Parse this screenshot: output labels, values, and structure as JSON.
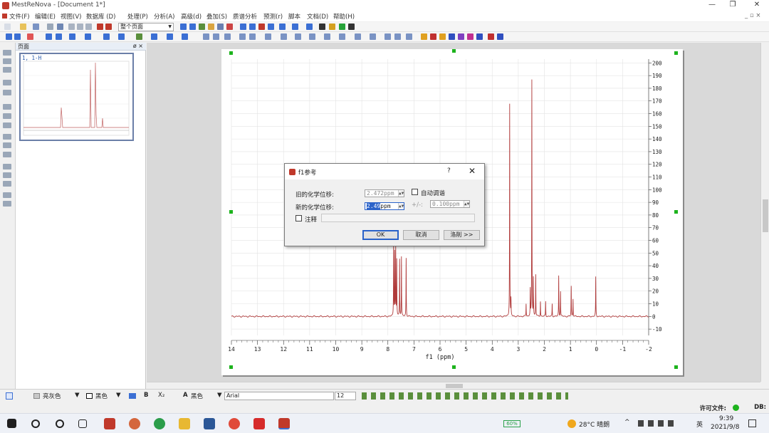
{
  "window": {
    "title": "MestReNova - [Document 1*]",
    "minimize": "—",
    "maximize": "❐",
    "close": "✕",
    "mdi_controls": "_ ▫ ×"
  },
  "menu": [
    "文件(F)",
    "编辑(E)",
    "视图(V)",
    "数据库 (D)",
    "处理(P)",
    "分析(A)",
    "高级(d)",
    "叠加(S)",
    "质谱分析",
    "预测(r)",
    "脚本",
    "文档(D)",
    "帮助(H)"
  ],
  "toolbar": {
    "page_select": "整个页面"
  },
  "pages_panel": {
    "title": "页面",
    "controls": "ø ×",
    "thumbnail_label": "1, 1-H"
  },
  "spectrum": {
    "xlabel": "f1 (ppm)",
    "x_ticks": [
      "14",
      "13",
      "12",
      "11",
      "10",
      "9",
      "8",
      "7",
      "6",
      "5",
      "4",
      "3",
      "2",
      "1",
      "0",
      "-1",
      "-2"
    ],
    "y_ticks": [
      "200",
      "190",
      "180",
      "170",
      "160",
      "150",
      "140",
      "130",
      "120",
      "110",
      "100",
      "90",
      "80",
      "70",
      "60",
      "50",
      "40",
      "30",
      "20",
      "10",
      "0",
      "-10"
    ],
    "line_color": "#b03a3a"
  },
  "chart_data": {
    "type": "line",
    "xlabel": "f1 (ppm)",
    "ylabel": "",
    "xlim": [
      14,
      -2
    ],
    "ylim": [
      -15,
      203
    ],
    "x_reversed": true,
    "grid": true,
    "series": [
      {
        "peaks": [
          {
            "ppm": 7.78,
            "height": 58
          },
          {
            "ppm": 7.74,
            "height": 50
          },
          {
            "ppm": 7.7,
            "height": 53
          },
          {
            "ppm": 7.66,
            "height": 44
          },
          {
            "ppm": 7.55,
            "height": 45
          },
          {
            "ppm": 7.48,
            "height": 47
          },
          {
            "ppm": 7.3,
            "height": 46
          },
          {
            "ppm": 3.33,
            "height": 168
          },
          {
            "ppm": 3.28,
            "height": 13
          },
          {
            "ppm": 2.7,
            "height": 10
          },
          {
            "ppm": 2.54,
            "height": 21
          },
          {
            "ppm": 2.48,
            "height": 186
          },
          {
            "ppm": 2.42,
            "height": 30
          },
          {
            "ppm": 2.33,
            "height": 33
          },
          {
            "ppm": 2.15,
            "height": 12
          },
          {
            "ppm": 1.95,
            "height": 12
          },
          {
            "ppm": 1.7,
            "height": 10
          },
          {
            "ppm": 1.45,
            "height": 32
          },
          {
            "ppm": 1.38,
            "height": 20
          },
          {
            "ppm": 0.97,
            "height": 24
          },
          {
            "ppm": 0.9,
            "height": 14
          },
          {
            "ppm": 0.03,
            "height": 31
          }
        ]
      }
    ]
  },
  "dialog": {
    "title": "f1参考",
    "help": "?",
    "close": "✕",
    "old_shift_label": "旧的化学位移:",
    "old_shift_value": "2.472ppm",
    "new_shift_label": "新的化学位移:",
    "new_shift_value": "2.49",
    "new_shift_unit": "ppm",
    "auto_tune_label": "自动调谐",
    "tolerance_prefix": "+/-:",
    "tolerance_value": "0.100ppm",
    "note_label": "注释",
    "ok": "OK",
    "cancel": "取消",
    "advanced": "洛削 >>"
  },
  "format_bar": {
    "fill": "亮灰色",
    "line": "黑色",
    "bold": "B",
    "subscript": "X₂",
    "font_color": "黑色",
    "font": "Arial",
    "size": "12"
  },
  "status": {
    "license": "许可文件:",
    "db": "DB:"
  },
  "taskbar": {
    "battery": "60%",
    "weather": "28°C 晴朗",
    "ime": "英",
    "time": "9:39",
    "date": "2021/9/8"
  }
}
